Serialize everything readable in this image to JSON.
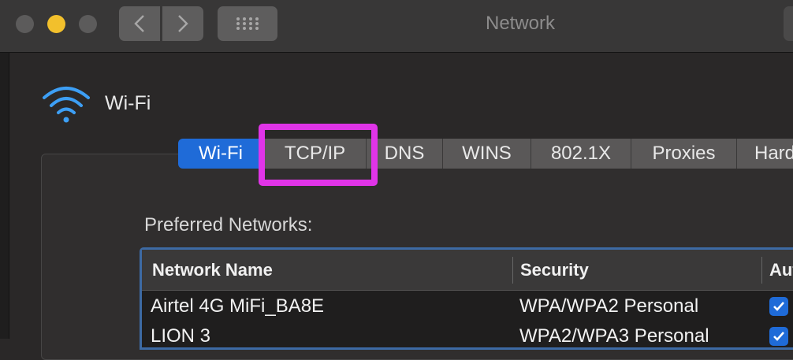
{
  "window": {
    "title": "Network"
  },
  "header": {
    "interface_name": "Wi-Fi",
    "icon": "wifi-icon"
  },
  "tabs": [
    {
      "label": "Wi-Fi",
      "active": true
    },
    {
      "label": "TCP/IP",
      "active": false
    },
    {
      "label": "DNS",
      "active": false
    },
    {
      "label": "WINS",
      "active": false
    },
    {
      "label": "802.1X",
      "active": false
    },
    {
      "label": "Proxies",
      "active": false
    },
    {
      "label": "Hard",
      "active": false
    }
  ],
  "preferred_networks": {
    "label": "Preferred Networks:",
    "columns": [
      "Network Name",
      "Security",
      "Aut"
    ],
    "rows": [
      {
        "name": "Airtel 4G MiFi_BA8E",
        "security": "WPA/WPA2 Personal",
        "auto_join": true
      },
      {
        "name": "LION 3",
        "security": "WPA2/WPA3 Personal",
        "auto_join": true
      }
    ]
  },
  "colors": {
    "accent": "#1f6bd8",
    "highlight": "#e034e8",
    "wifi_icon": "#3d9ff5",
    "minimize_button": "#f2c02c"
  }
}
